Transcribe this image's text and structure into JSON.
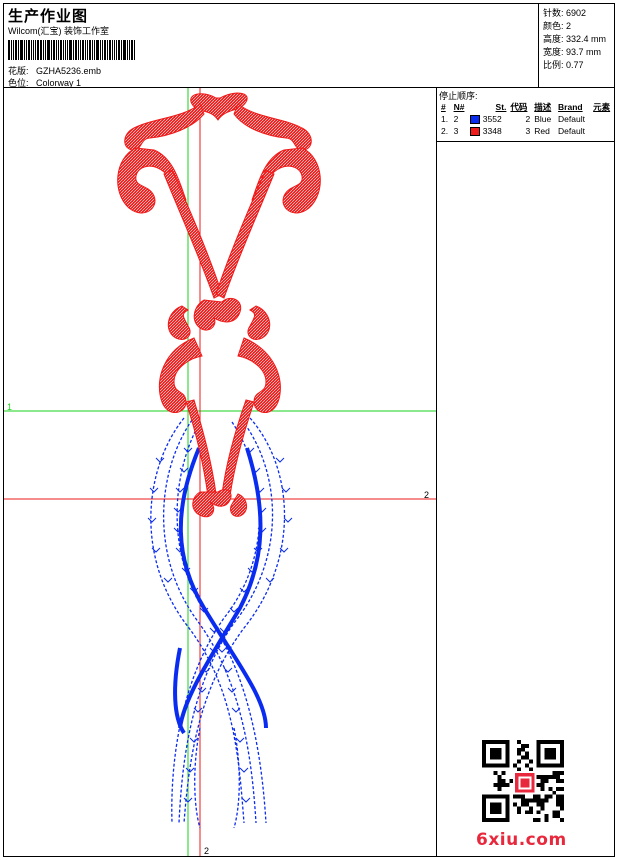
{
  "header": {
    "title": "生产作业图",
    "company": "Wilcom(汇宝) 装饰工作室",
    "design_label": "花版:",
    "design_value": "GZHA5236.emb",
    "colorway_label": "色位:",
    "colorway_value": "Colorway 1"
  },
  "specs": [
    {
      "label": "针数:",
      "value": "6902"
    },
    {
      "label": "颜色:",
      "value": "2"
    },
    {
      "label": "高度:",
      "value": "332.4 mm"
    },
    {
      "label": "宽度:",
      "value": "93.7 mm"
    },
    {
      "label": "比例:",
      "value": "0.77"
    }
  ],
  "stop_sequence": {
    "title": "停止顺序:",
    "headers": [
      "#",
      "N#",
      "St.",
      "代码",
      "描述",
      "Brand",
      "元素"
    ],
    "rows": [
      {
        "idx": "1.",
        "n": "2",
        "color": "#0a2cf0",
        "st": "3552",
        "code": "2",
        "desc": "Blue",
        "brand": "Default",
        "elem": ""
      },
      {
        "idx": "2.",
        "n": "3",
        "color": "#ee1b1b",
        "st": "3348",
        "code": "3",
        "desc": "Red",
        "brand": "Default",
        "elem": ""
      }
    ]
  },
  "guides": {
    "label_1": "1",
    "label_2_right": "2",
    "label_2_bottom": "2"
  },
  "colors": {
    "red": "#ee1b1b",
    "blue": "#0a2cf0",
    "green": "#19d219"
  },
  "watermark": "6xiu.com"
}
